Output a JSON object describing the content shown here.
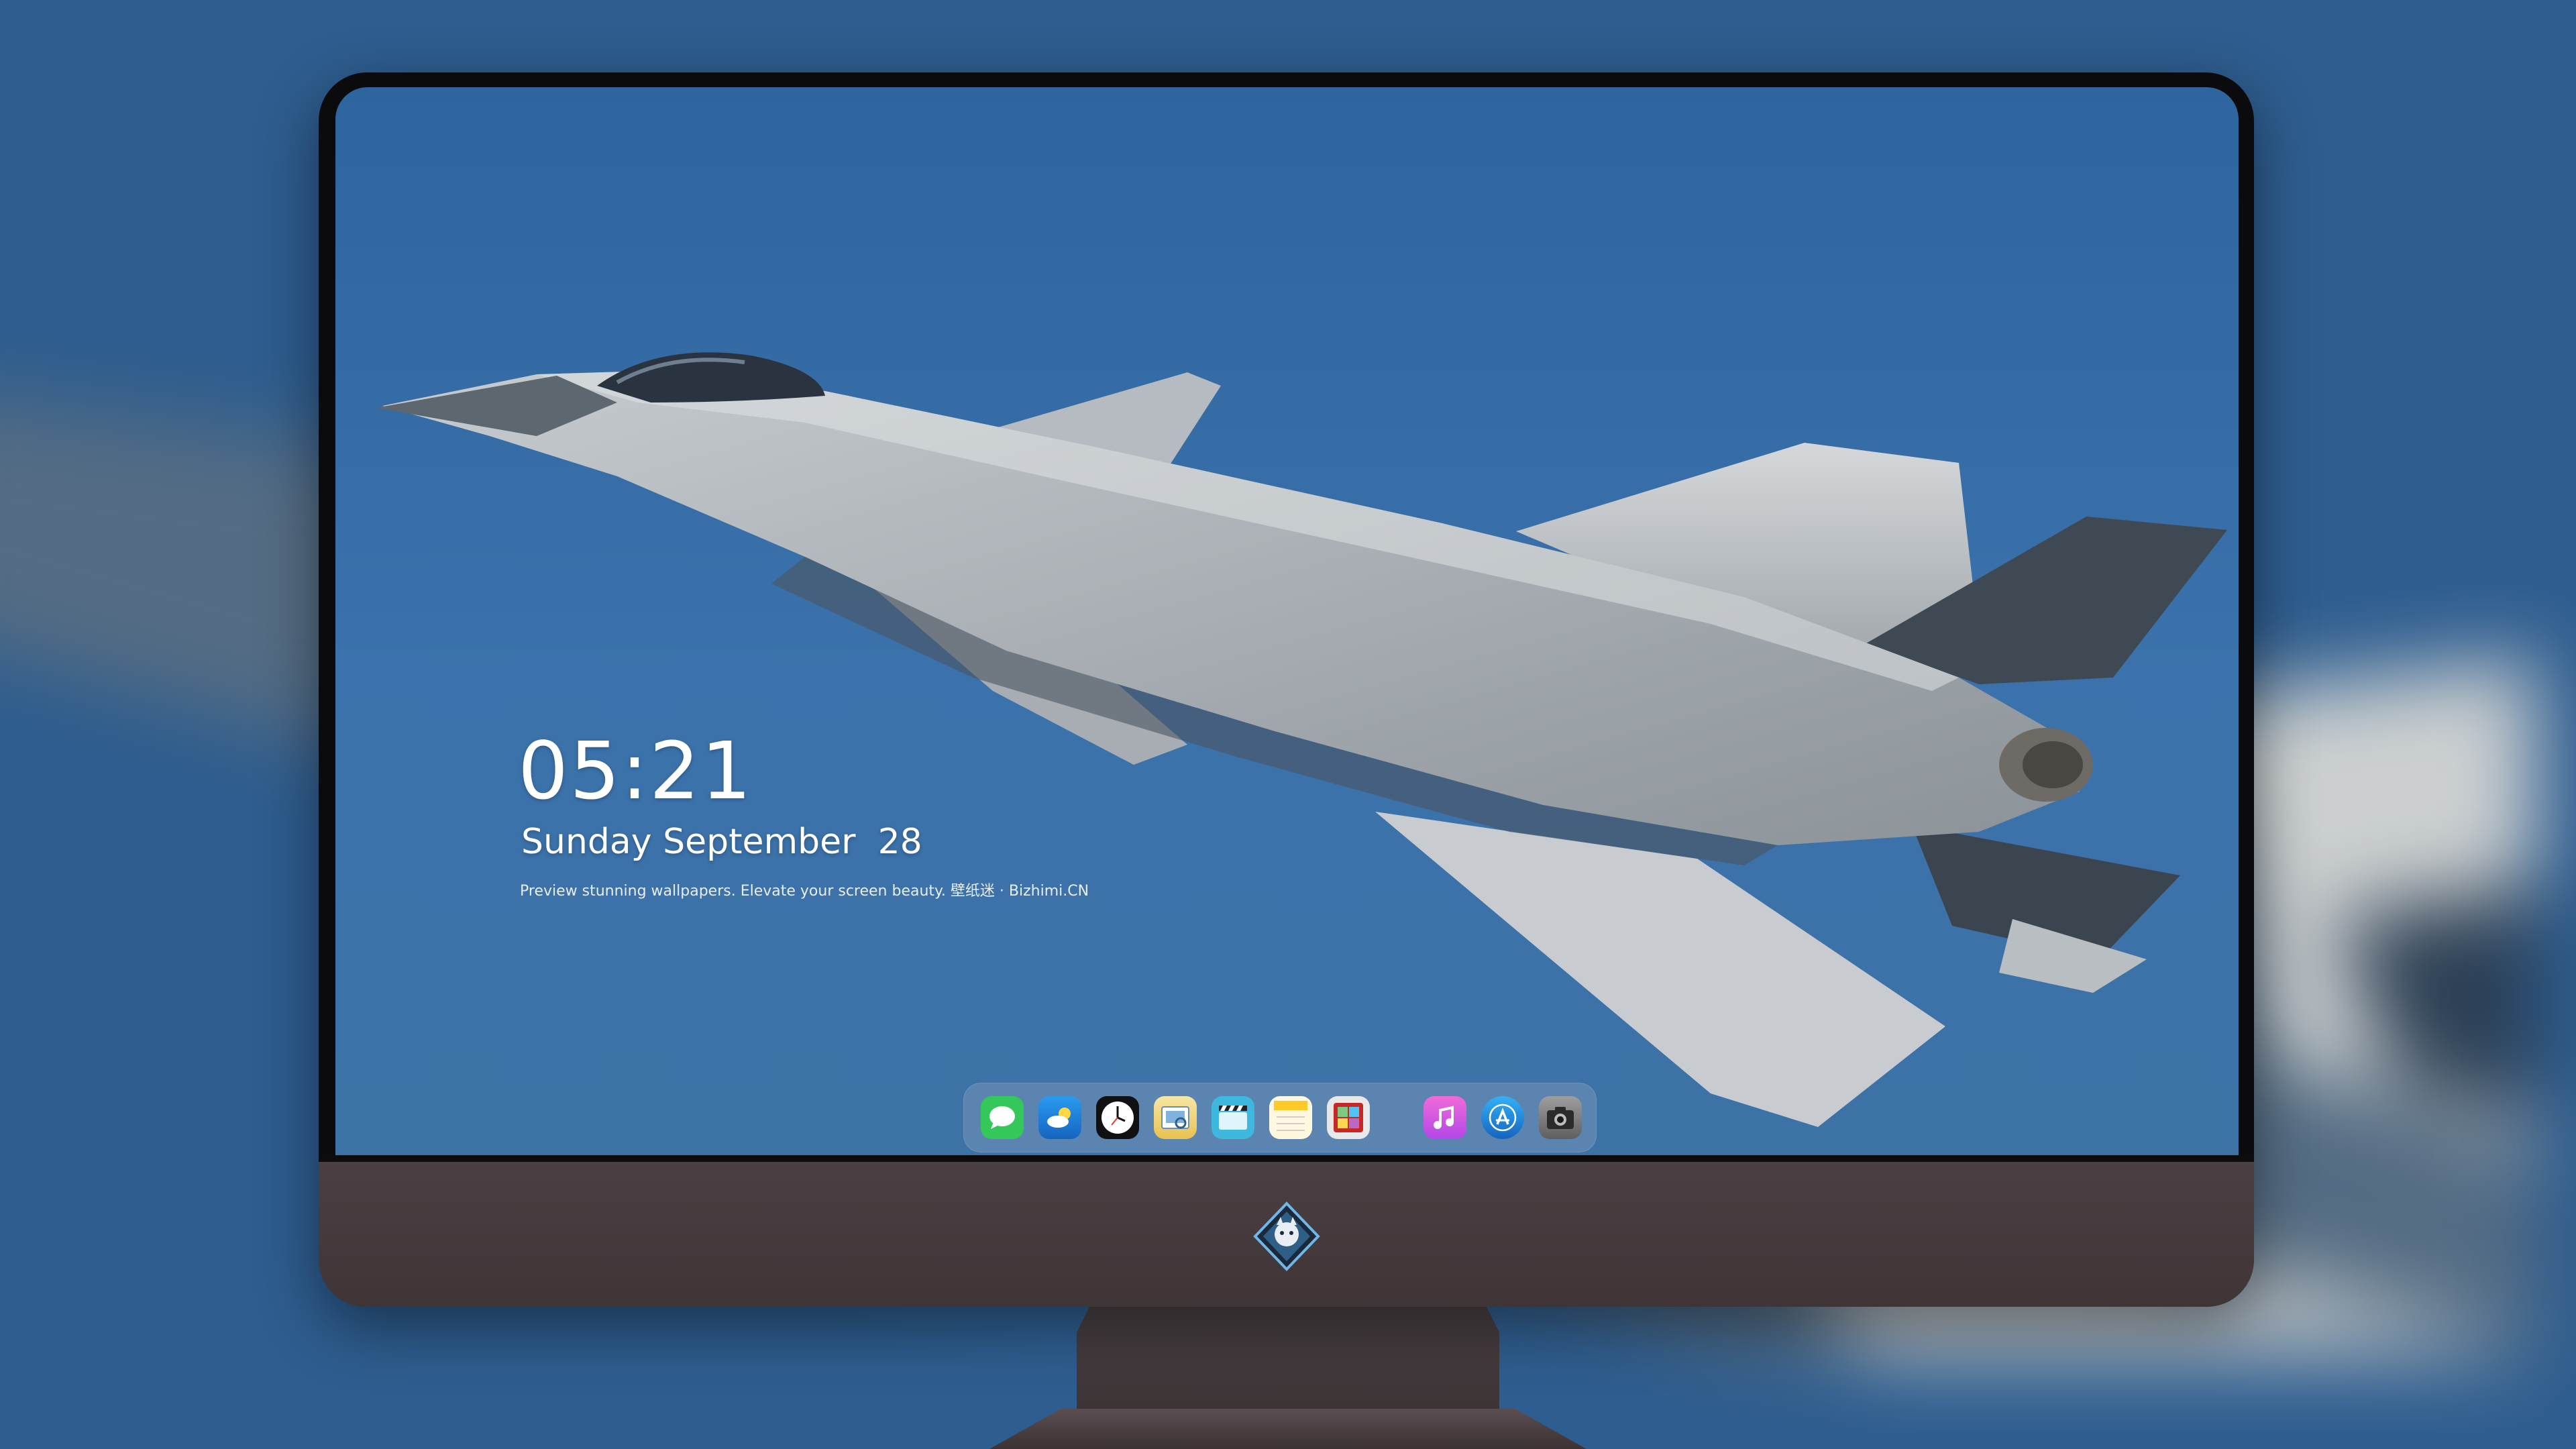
{
  "lockscreen": {
    "time": "05:21",
    "date": "Sunday September  28",
    "tagline": "Preview stunning wallpapers. Elevate your screen beauty. 壁纸迷 · Bizhimi.CN"
  },
  "dock": {
    "apps": [
      {
        "name": "messages-icon",
        "color": "#34c759"
      },
      {
        "name": "weather-icon",
        "color": "#1e88e5"
      },
      {
        "name": "clock-icon",
        "color": "#111111"
      },
      {
        "name": "preview-icon",
        "color": "#f2c94c"
      },
      {
        "name": "clips-icon",
        "color": "#4fc3e8"
      },
      {
        "name": "notes-icon",
        "color": "#ffd54f"
      },
      {
        "name": "photo-booth-icon",
        "color": "#d32f2f"
      },
      {
        "name": "itunes-icon",
        "color": "#e040fb"
      },
      {
        "name": "app-store-icon",
        "color": "#1e88e5"
      },
      {
        "name": "camera-icon",
        "color": "#6d6d6d"
      }
    ]
  },
  "colors": {
    "sky": "#3b72ab",
    "monitor_chin": "#4a3f42",
    "bezel": "#0b0b0d"
  }
}
